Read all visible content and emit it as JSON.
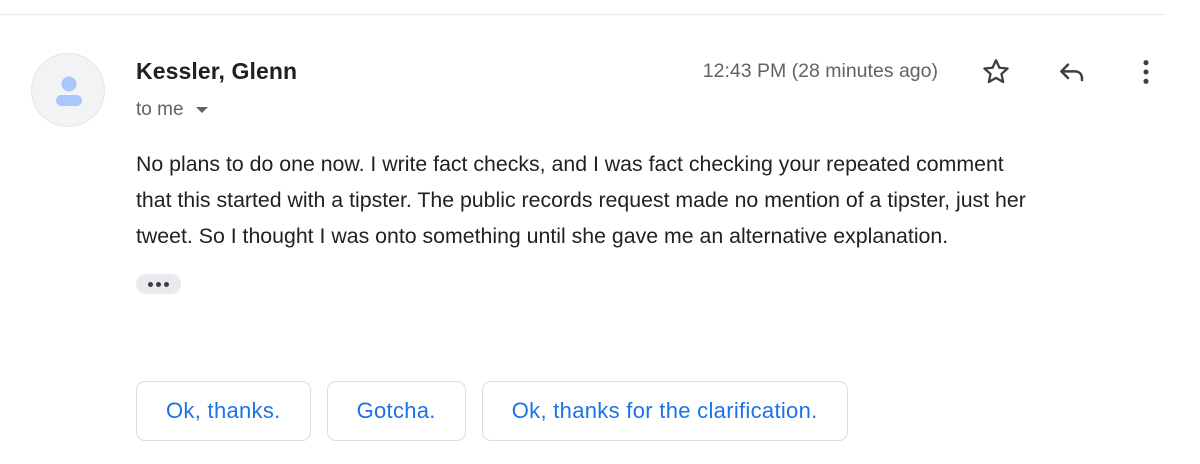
{
  "message": {
    "sender_name": "Kessler, Glenn",
    "recipient_label": "to me",
    "timestamp": "12:43 PM (28 minutes ago)",
    "body_lines": [
      "No plans to do one now. I write fact checks, and I was fact checking your repeated comment",
      "that this started with a tipster. The public records request made no mention of a tipster, just her",
      "tweet. So I thought I was onto something until she gave me an alternative explanation."
    ]
  },
  "actions": {
    "star_icon": "star-outline-icon",
    "reply_icon": "reply-arrow-icon",
    "more_icon": "vertical-dots-icon",
    "trimmed_content_icon": "horizontal-dots-icon"
  },
  "smart_replies": [
    "Ok, thanks.",
    "Gotcha.",
    "Ok, thanks for the clarification."
  ],
  "colors": {
    "accent": "#1a73e8",
    "avatar_icon": "#a8c7fa",
    "secondary_text": "#5f6368"
  }
}
